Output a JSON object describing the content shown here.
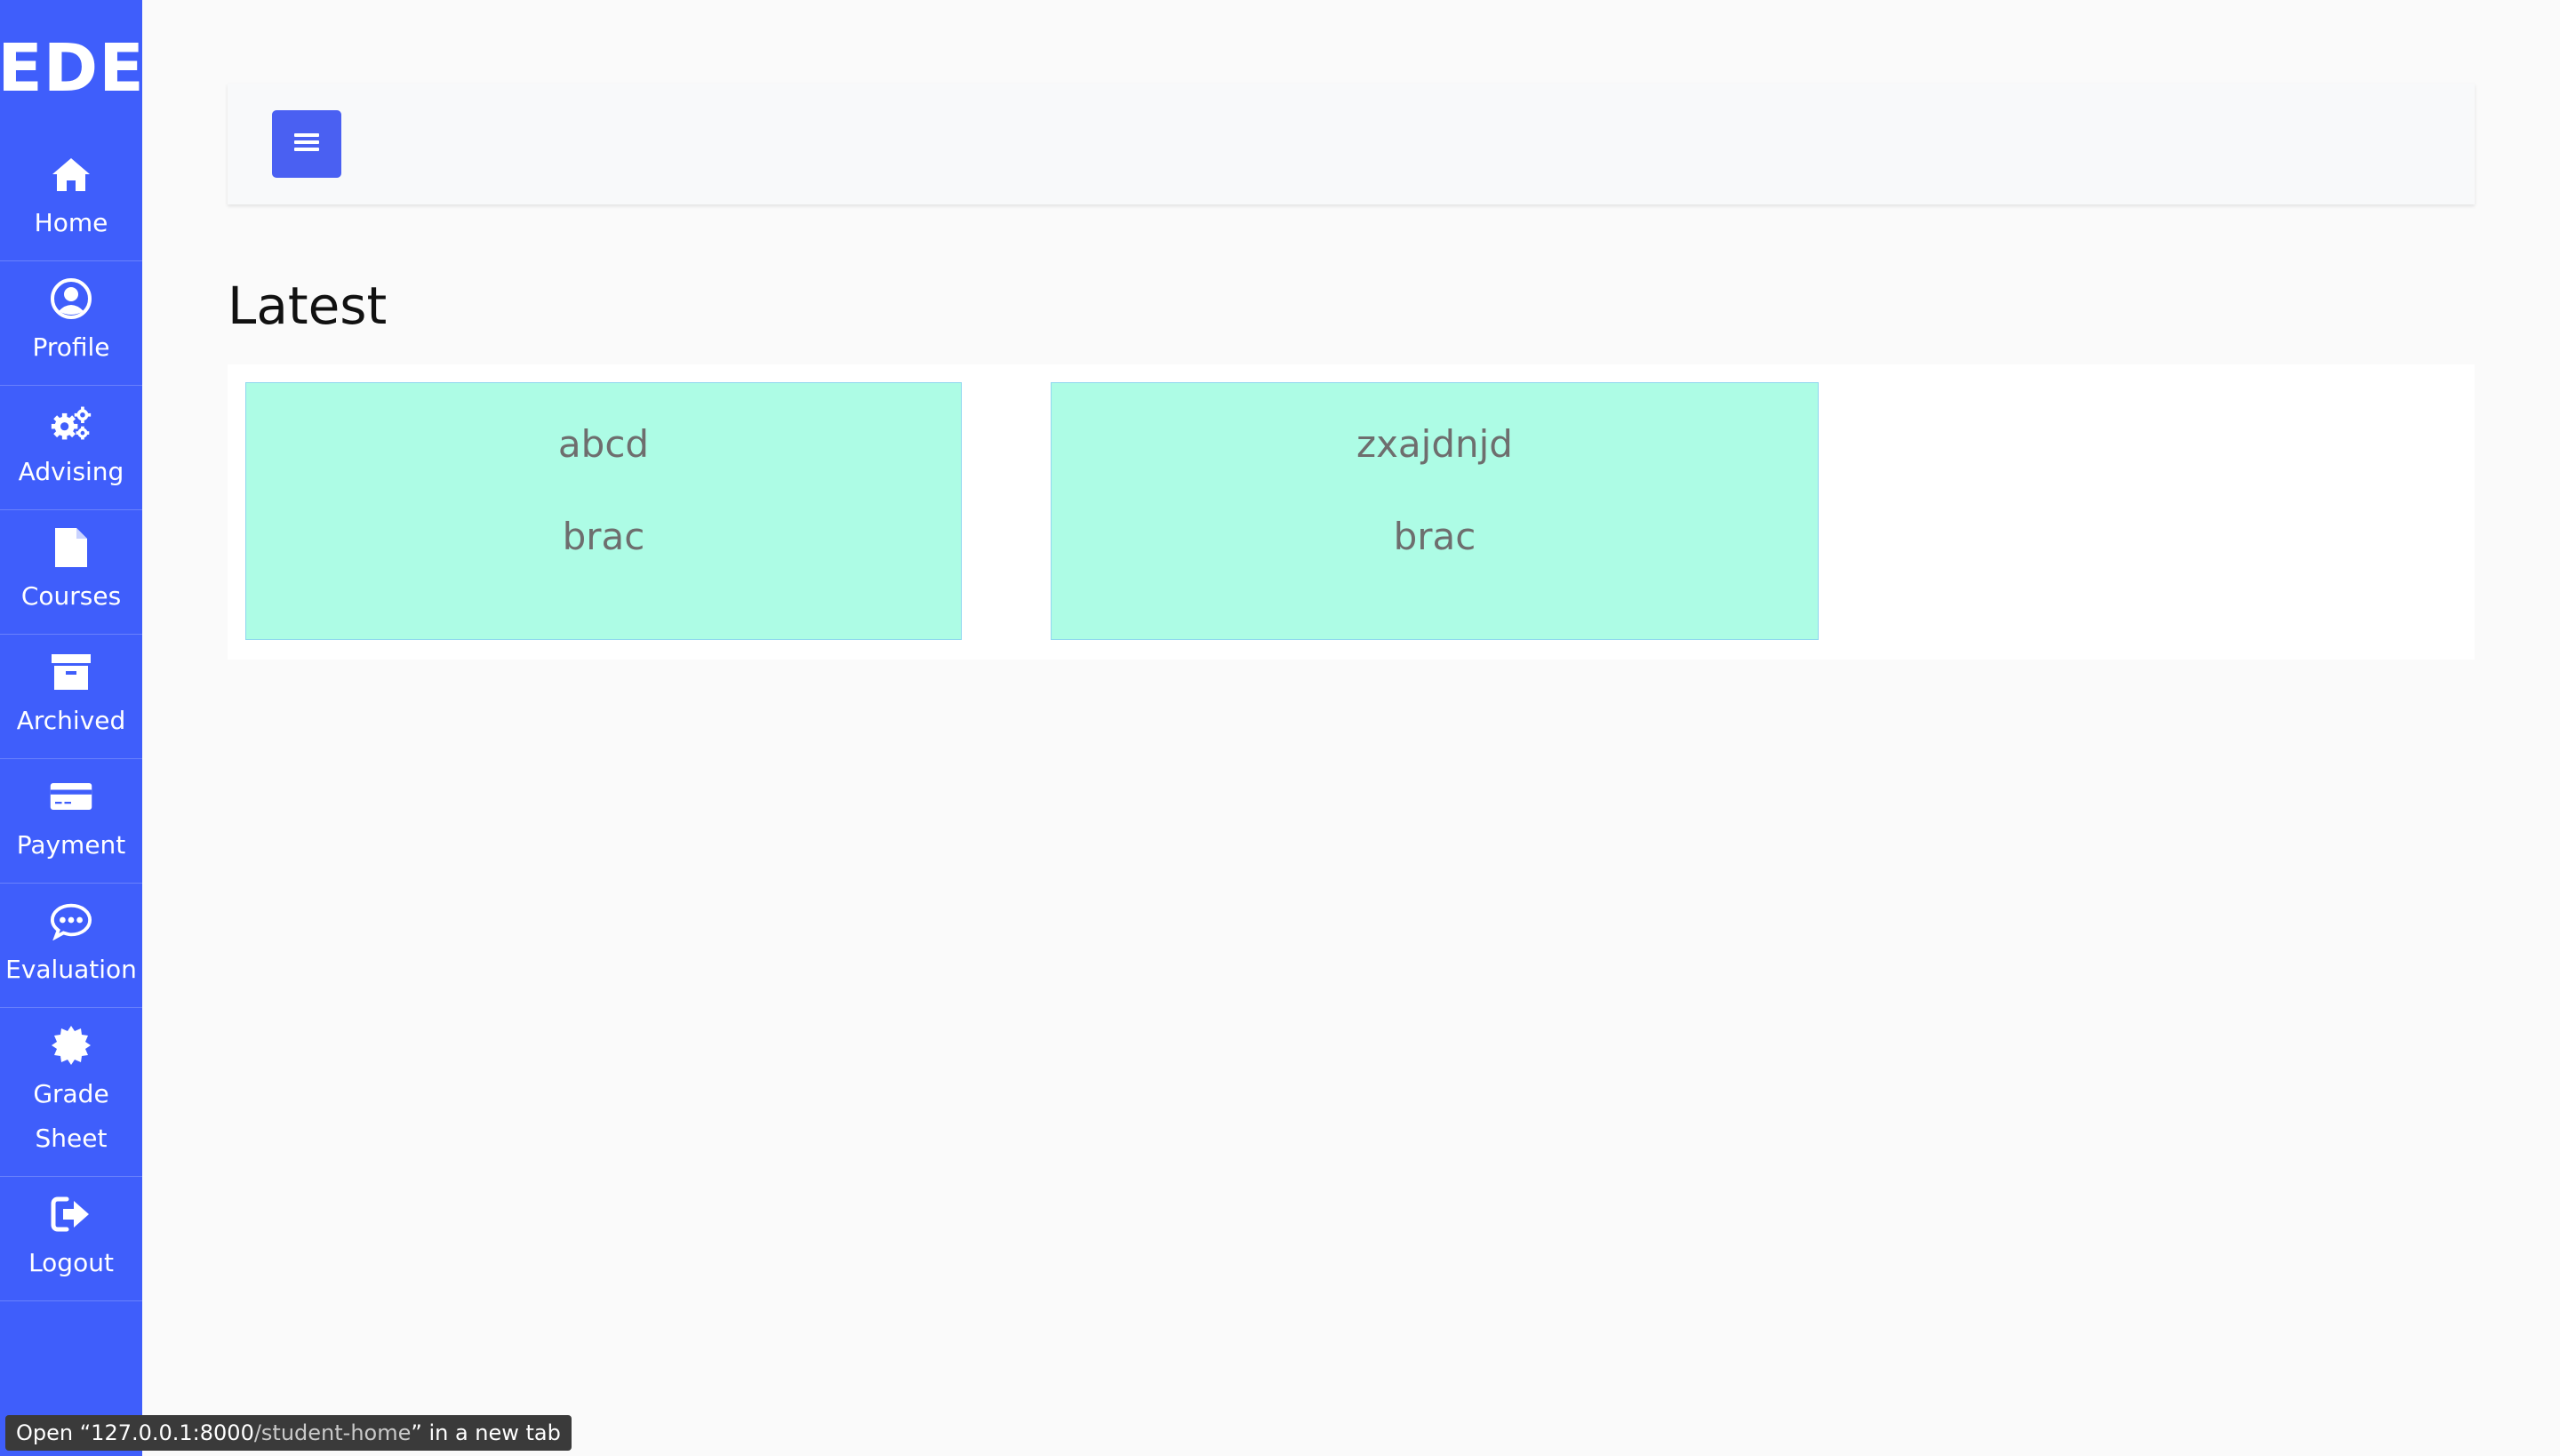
{
  "sidebar": {
    "logo": "EDE",
    "items": [
      {
        "label": "Home",
        "icon": "home-icon"
      },
      {
        "label": "Profile",
        "icon": "user-circle-icon"
      },
      {
        "label": "Advising",
        "icon": "gears-icon"
      },
      {
        "label": "Courses",
        "icon": "file-icon"
      },
      {
        "label": "Archived",
        "icon": "archive-icon"
      },
      {
        "label": "Payment",
        "icon": "credit-card-icon"
      },
      {
        "label": "Evaluation",
        "icon": "comment-dots-icon"
      },
      {
        "label": "Grade\nSheet",
        "icon": "certificate-icon"
      },
      {
        "label": "Logout",
        "icon": "sign-out-icon"
      }
    ]
  },
  "topbar": {
    "menu_icon": "hamburger-icon"
  },
  "main": {
    "heading": "Latest",
    "cards": [
      {
        "title": "abcd",
        "subtitle": "brac"
      },
      {
        "title": "zxajdnjd",
        "subtitle": "brac"
      }
    ]
  },
  "status_bar": {
    "prefix": "Open “",
    "host": "127.0.0.1:8000",
    "path": "/student-home",
    "suffix": "” in a new tab"
  },
  "colors": {
    "sidebar": "#3f5efb",
    "menu_button": "#4a60f2",
    "card_bg": "#adfce5",
    "card_border": "#8fd6ef",
    "page_bg": "#fafafa"
  }
}
